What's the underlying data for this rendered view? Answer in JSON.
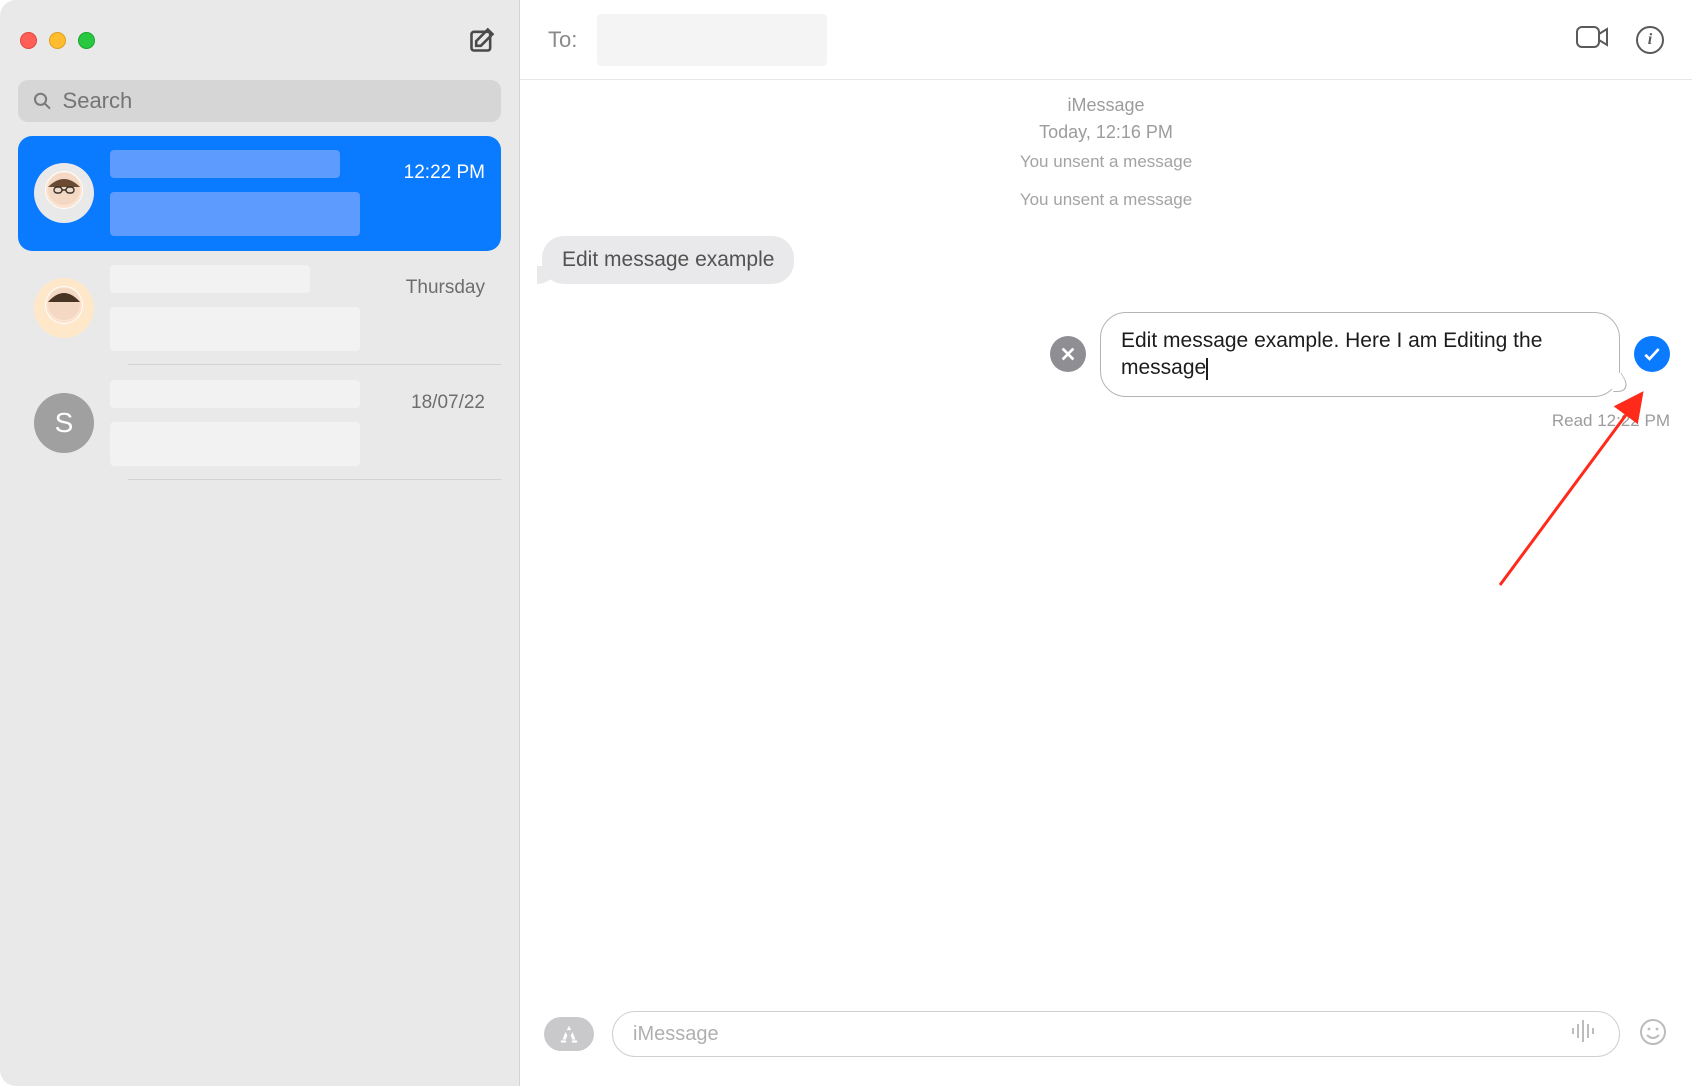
{
  "sidebar": {
    "search_placeholder": "Search",
    "conversations": [
      {
        "time": "12:22 PM",
        "avatar": "memoji1",
        "letter": ""
      },
      {
        "time": "Thursday",
        "avatar": "memoji2",
        "letter": ""
      },
      {
        "time": "18/07/22",
        "avatar": "letter",
        "letter": "S"
      }
    ]
  },
  "header": {
    "to_label": "To:"
  },
  "thread": {
    "service_label": "iMessage",
    "date_label": "Today, 12:16 PM",
    "unsent_notices": [
      "You unsent a message",
      "You unsent a message"
    ],
    "incoming_bubble": "Edit message example",
    "edit_text": "Edit message example. Here I am Editing the message",
    "read_receipt": "Read 12:22 PM"
  },
  "composer": {
    "placeholder": "iMessage"
  }
}
